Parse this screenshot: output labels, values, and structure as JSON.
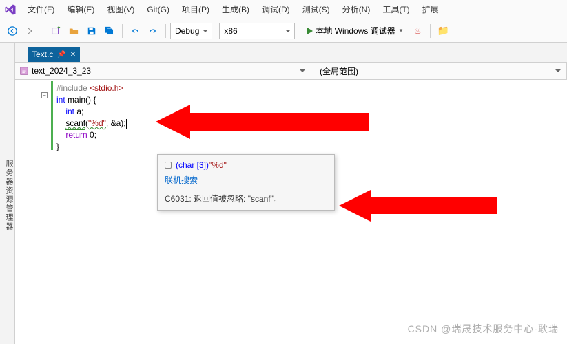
{
  "menu": {
    "items": [
      "文件(F)",
      "编辑(E)",
      "视图(V)",
      "Git(G)",
      "项目(P)",
      "生成(B)",
      "调试(D)",
      "测试(S)",
      "分析(N)",
      "工具(T)",
      "扩展"
    ]
  },
  "toolbar": {
    "config": "Debug",
    "platform": "x86",
    "debugger": "本地 Windows 调试器"
  },
  "sidebar": {
    "label": "服务器资源管理器"
  },
  "tab": {
    "filename": "Text.c"
  },
  "nav": {
    "project": "text_2024_3_23",
    "scope": "(全局范围)"
  },
  "code": {
    "l1a": "#include ",
    "l1b": "<stdio.h>",
    "l2a": "int",
    "l2b": " main() {",
    "l3a": "    ",
    "l3b": "int",
    "l3c": " a;",
    "l4a": "    ",
    "l4b": "scanf",
    "l4c": "(",
    "l4d": "\"%d\"",
    "l4e": ", &a);",
    "l5a": "    ",
    "l5b": "return",
    "l5c": " 0;",
    "l6": "}"
  },
  "tooltip": {
    "type": "(char [3])",
    "value": "\"%d\"",
    "link": "联机搜索",
    "warning": "C6031: 返回值被忽略: \"scanf\"。"
  },
  "watermark": "CSDN @瑞晟技术服务中心-耿瑞"
}
